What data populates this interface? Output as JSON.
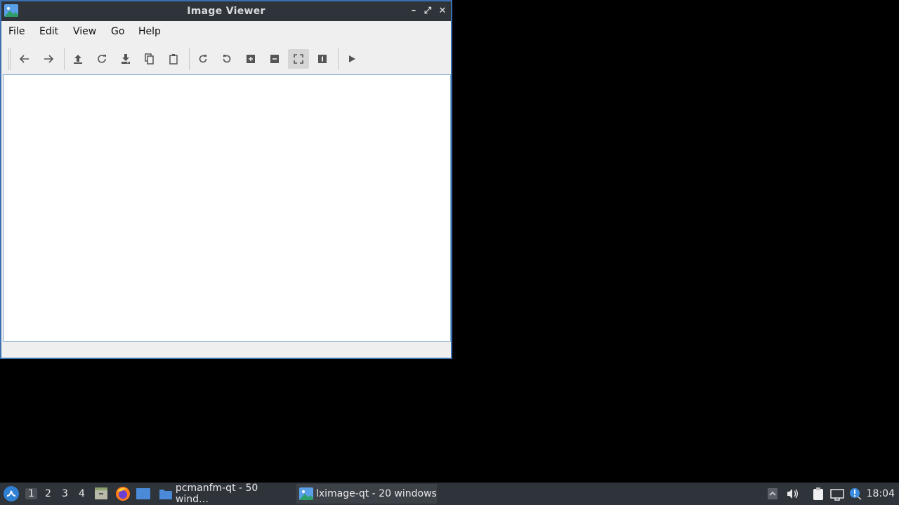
{
  "window": {
    "title": "Image Viewer",
    "controls": {
      "minimize": "–",
      "maximize": "⤢",
      "close": "✕"
    }
  },
  "menu": [
    "File",
    "Edit",
    "View",
    "Go",
    "Help"
  ],
  "toolbar": {
    "buttons": [
      "back",
      "forward",
      "open",
      "reload",
      "save",
      "copy",
      "paste",
      "rotate-clockwise",
      "rotate-counterclockwise",
      "zoom-in",
      "zoom-out",
      "fit-window",
      "info",
      "slideshow"
    ],
    "active": "fit-window"
  },
  "taskbar": {
    "workspaces": [
      "1",
      "2",
      "3",
      "4"
    ],
    "active_workspace": "1",
    "tasks": [
      {
        "label": "pcmanfm-qt - 50 wind…",
        "icon": "folder-icon"
      },
      {
        "label": "lximage-qt - 20 windows",
        "icon": "image-viewer-icon"
      }
    ],
    "clock": "18:04"
  },
  "colors": {
    "titlebar": "#2f333a",
    "window_border": "#3a6fb0",
    "canvas_border": "#7ea6cf",
    "desktop": "#000000"
  }
}
